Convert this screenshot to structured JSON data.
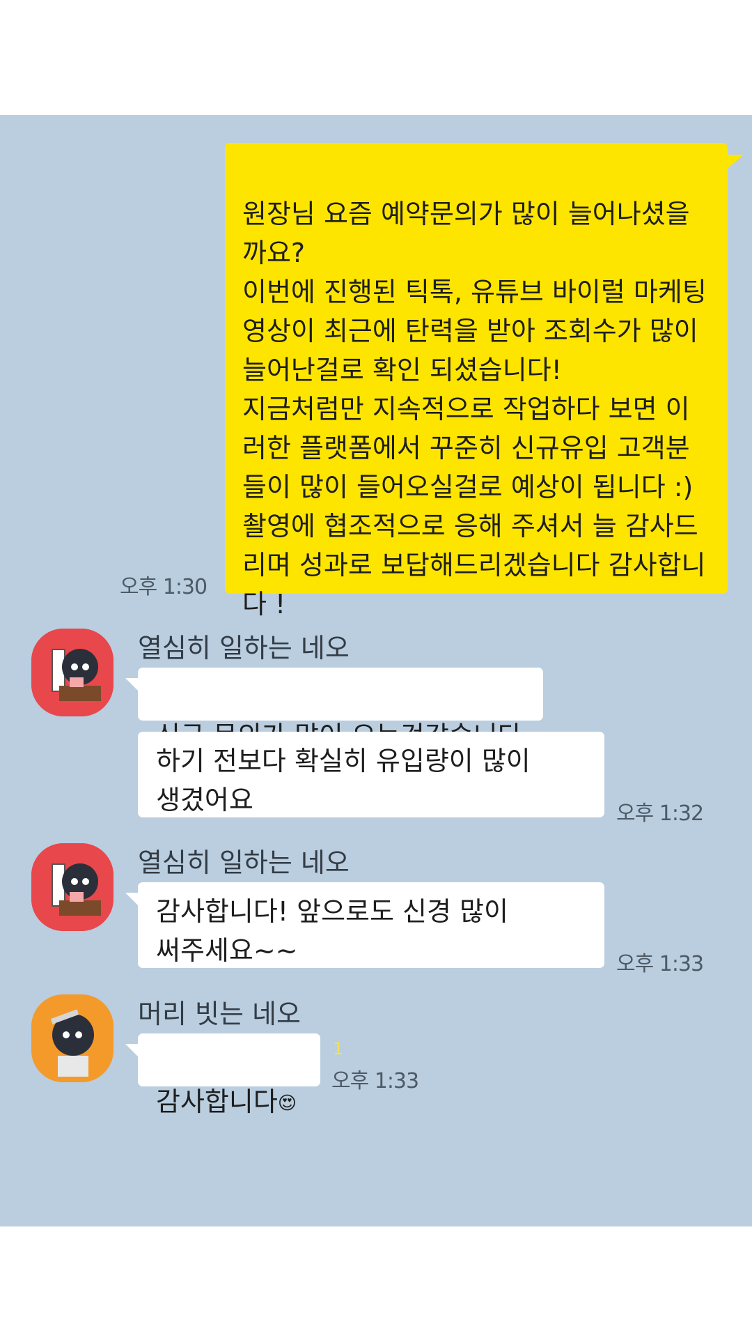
{
  "messages": {
    "outgoing": {
      "text": "원장님 요즘 예약문의가 많이 늘어나셨을까요?\n이번에 진행된 틱톡, 유튜브 바이럴 마케팅 영상이 최근에 탄력을 받아 조회수가 많이 늘어난걸로 확인 되셨습니다!\n지금처럼만 지속적으로 작업하다 보면 이러한 플랫폼에서 꾸준히 신규유입 고객분들이 많이 들어오실걸로 예상이 됩니다 :)\n촬영에 협조적으로 응해 주셔서 늘 감사드리며 성과로 보답해드리겠습니다 감사합니다 !",
      "time": "오후 1:30"
    },
    "group1": {
      "sender": "열심히 일하는 네오",
      "bubble1": "신규 문의가 많이 오는것같습니다",
      "bubble2": "하기 전보다 확실히 유입량이 많이 생겼어요",
      "time": "오후 1:32"
    },
    "group2": {
      "sender": "열심히 일하는 네오",
      "bubble1": "감사합니다! 앞으로도 신경 많이 써주세요~~",
      "time": "오후 1:33"
    },
    "group3": {
      "sender": "머리 빗는 네오",
      "bubble1": "감사합니다",
      "emoji": "😍",
      "unread": "1",
      "time": "오후 1:33"
    }
  },
  "avatars": {
    "neo_working": {
      "icon": "neo-working-avatar-icon",
      "bg": "#e8474b"
    },
    "neo_combing": {
      "icon": "neo-combing-avatar-icon",
      "bg": "#f39a2b"
    }
  },
  "colors": {
    "chat_bg": "#bacee0",
    "my_bubble": "#fee500",
    "their_bubble": "#ffffff"
  }
}
